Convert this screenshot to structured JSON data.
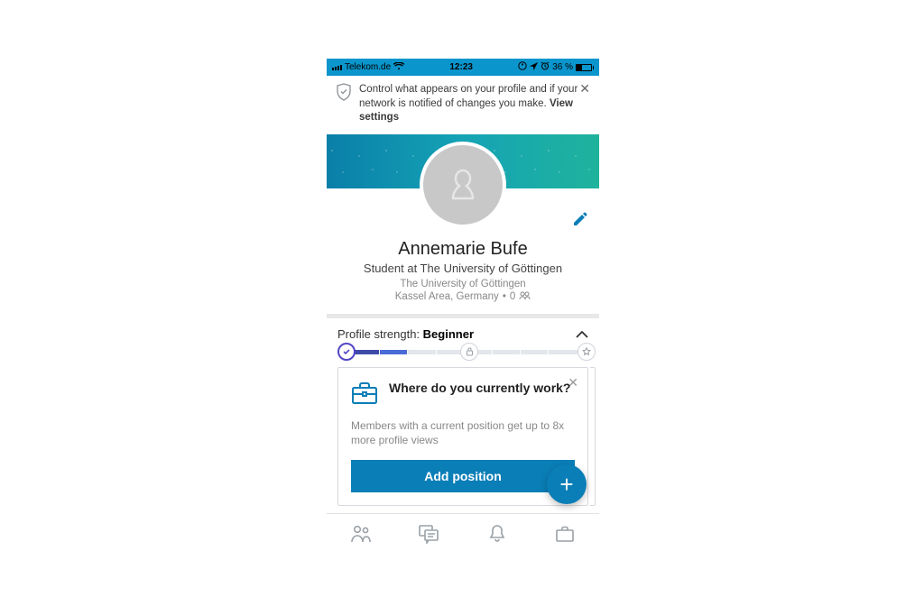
{
  "status": {
    "carrier": "Telekom.de",
    "time": "12:23",
    "battery_pct": "36 %"
  },
  "banner": {
    "text_prefix": "Control what appears on your profile and if your network is notified of changes you make. ",
    "link": "View settings"
  },
  "profile": {
    "name": "Annemarie Bufe",
    "headline": "Student at The University of Göttingen",
    "school": "The University of Göttingen",
    "location": "Kassel Area, Germany",
    "connections": "0"
  },
  "strength": {
    "label": "Profile strength:",
    "level": "Beginner"
  },
  "card": {
    "question": "Where do you currently work?",
    "subtext": "Members with a current position get up to 8x more profile views",
    "cta": "Add position"
  }
}
